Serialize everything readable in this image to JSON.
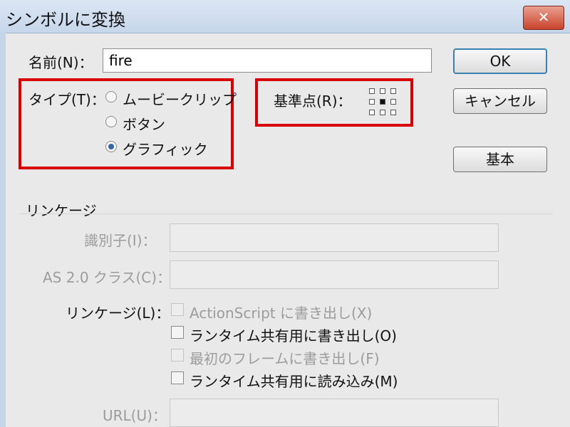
{
  "dialog": {
    "title": "シンボルに変換",
    "close_glyph": "✕"
  },
  "name": {
    "label": "名前(N)：",
    "value": "fire"
  },
  "buttons": {
    "ok": "OK",
    "cancel": "キャンセル",
    "basic": "基本"
  },
  "type": {
    "label": "タイプ(T)：",
    "options": [
      {
        "label": "ムービークリップ",
        "checked": false
      },
      {
        "label": "ボタン",
        "checked": false
      },
      {
        "label": "グラフィック",
        "checked": true
      }
    ]
  },
  "registration": {
    "label": "基準点(R)：",
    "selected": "center"
  },
  "linkage": {
    "section_title": "リンケージ",
    "identifier_label": "識別子(I)：",
    "as_class_label": "AS 2.0 クラス(C)：",
    "linkage_label": "リンケージ(L)：",
    "options": [
      {
        "label": "ActionScript に書き出し(X)",
        "enabled": false,
        "checked": false
      },
      {
        "label": "ランタイム共有用に書き出し(O)",
        "enabled": true,
        "checked": false
      },
      {
        "label": "最初のフレームに書き出し(F)",
        "enabled": false,
        "checked": false
      },
      {
        "label": "ランタイム共有用に読み込み(M)",
        "enabled": true,
        "checked": false
      }
    ],
    "url_label": "URL(U)："
  },
  "colors": {
    "highlight_box": "#d80000",
    "selected_radio": "#2e67a8"
  }
}
